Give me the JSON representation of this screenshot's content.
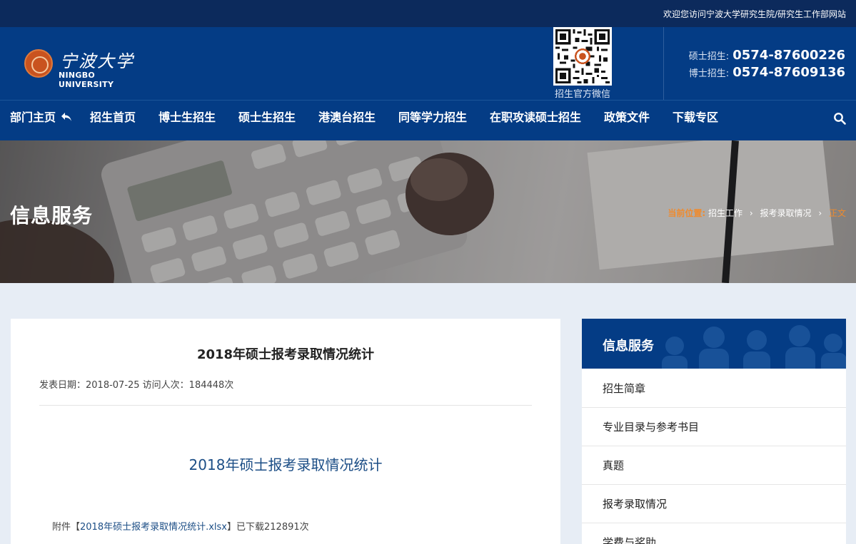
{
  "topbar": {
    "welcome": "欢迎您访问宁波大学研究生院/研究生工作部网站"
  },
  "header": {
    "logo_cn": "宁波大学",
    "logo_en": "NINGBO UNIVERSITY",
    "qr_label": "招生官方微信",
    "phones": [
      {
        "label": "硕士招生:",
        "number": "0574-87600226"
      },
      {
        "label": "博士招生:",
        "number": "0574-87609136"
      }
    ]
  },
  "nav": {
    "items": [
      "部门主页",
      "招生首页",
      "博士生招生",
      "硕士生招生",
      "港澳台招生",
      "同等学力招生",
      "在职攻读硕士招生",
      "政策文件",
      "下载专区"
    ],
    "search_icon": "search-icon"
  },
  "banner": {
    "title": "信息服务",
    "breadcrumb": {
      "lead": "当前位置:",
      "items": [
        "招生工作",
        "报考录取情况"
      ],
      "current": "正文"
    }
  },
  "article": {
    "title": "2018年硕士报考录取情况统计",
    "meta": "发表日期：2018-07-25  访问人次：184448次",
    "heading": "2018年硕士报考录取情况统计",
    "attach_prefix": "附件【",
    "attach_link": "2018年硕士报考录取情况统计.xlsx",
    "attach_suffix": "】已下载212891次"
  },
  "sidebar": {
    "title": "信息服务",
    "items": [
      "招生简章",
      "专业目录与参考书目",
      "真题",
      "报考录取情况",
      "学费与奖助"
    ]
  },
  "colors": {
    "primary": "#043c85",
    "topbar": "#0c2a5c",
    "accent": "#f08a2c",
    "link": "#1c4e86"
  }
}
